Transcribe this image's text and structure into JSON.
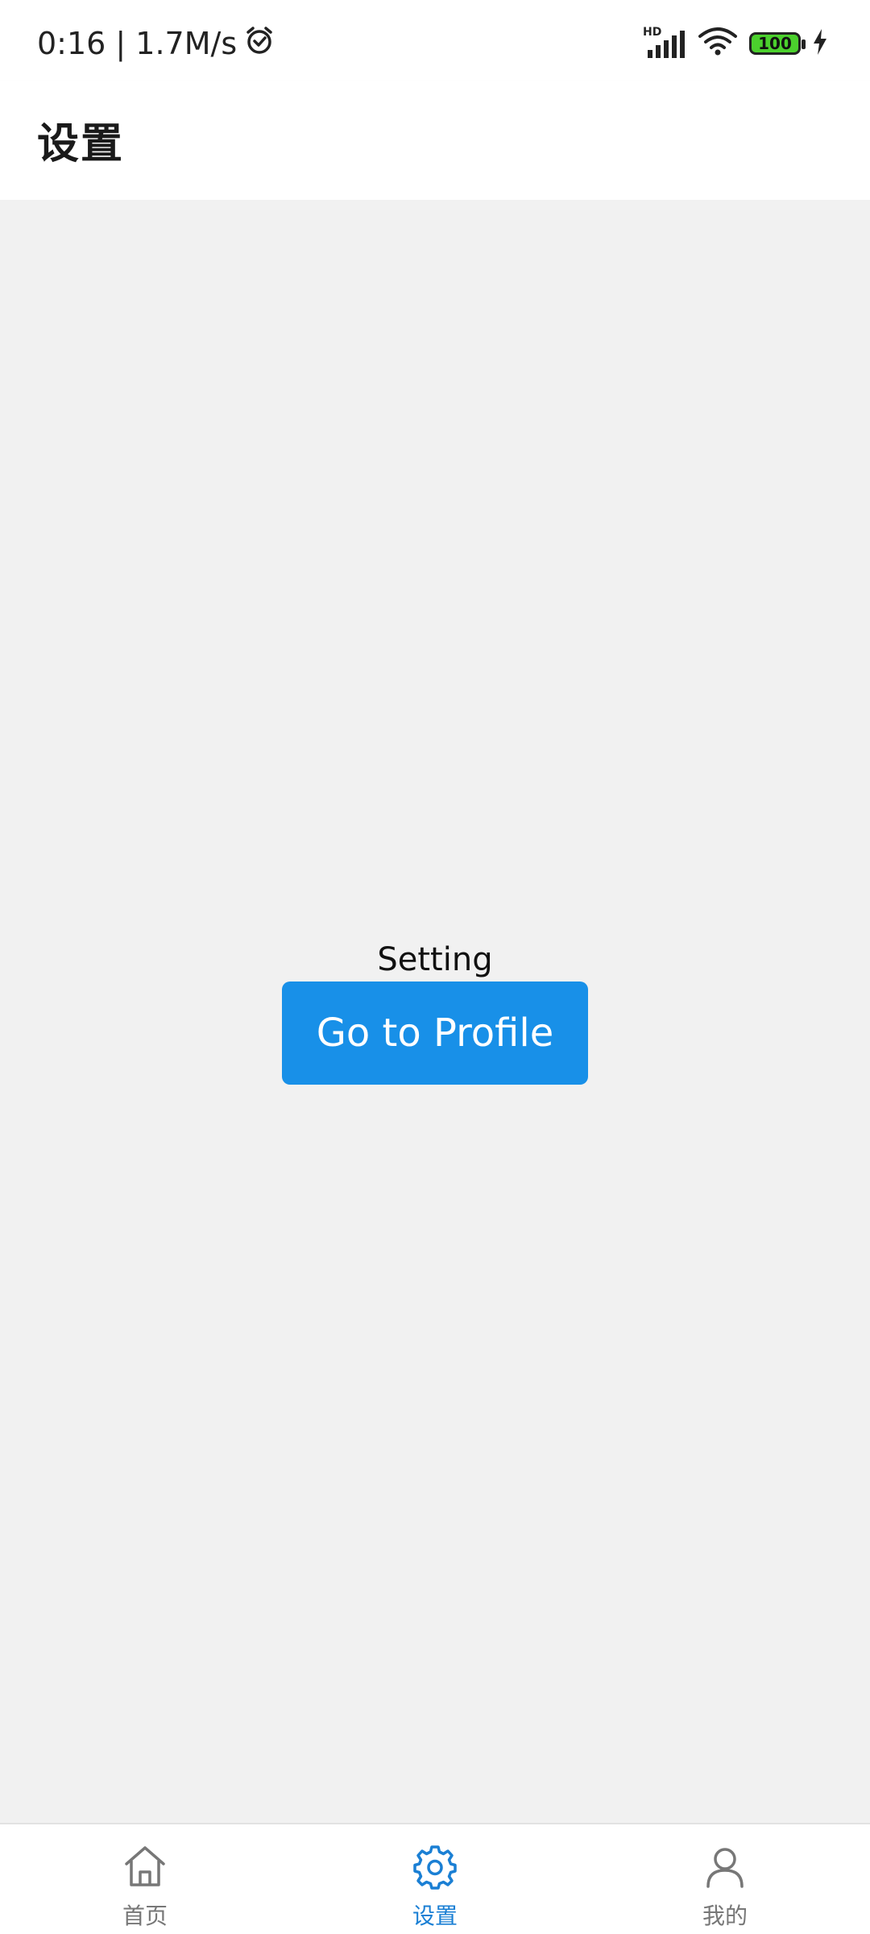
{
  "status_bar": {
    "time_speed": "0:16 | 1.7M/s",
    "network_type": "HD",
    "battery_level": "100",
    "icons": [
      "alarm-icon",
      "signal-icon",
      "wifi-icon",
      "battery-icon",
      "charging-icon"
    ]
  },
  "header": {
    "title": "设置"
  },
  "main": {
    "label": "Setting",
    "button_label": "Go to Profile"
  },
  "bottom_nav": {
    "items": [
      {
        "label": "首页",
        "icon": "home-icon",
        "active": false
      },
      {
        "label": "设置",
        "icon": "settings-icon",
        "active": true
      },
      {
        "label": "我的",
        "icon": "profile-icon",
        "active": false
      }
    ]
  },
  "colors": {
    "accent": "#1890e8",
    "active_nav": "#1a7fd4",
    "inactive_nav": "#777777",
    "background": "#f1f1f1",
    "battery": "#4bd02d"
  }
}
